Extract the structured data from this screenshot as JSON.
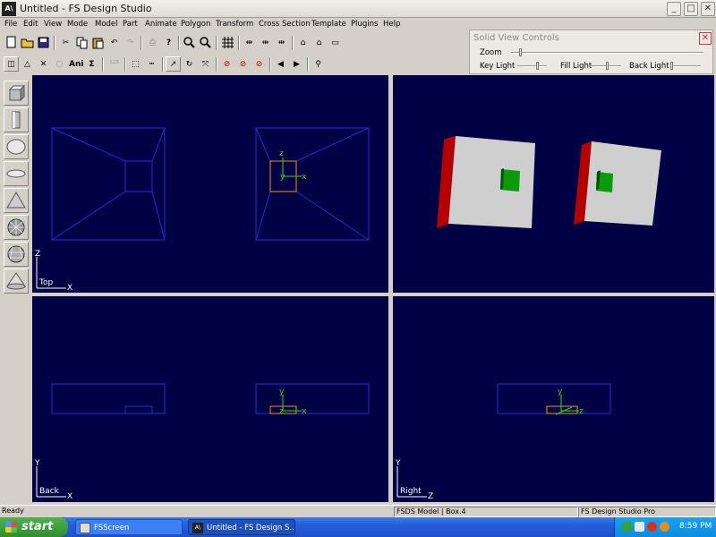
{
  "window": {
    "title": "Untitled - FS Design Studio",
    "app_icon": "fsds-logo-icon",
    "buttons": [
      "minimize-icon",
      "maximize-icon",
      "close-icon"
    ]
  },
  "menu": [
    "File",
    "Edit",
    "View",
    "Mode",
    "Model",
    "Part",
    "Animate",
    "Polygon",
    "Transform",
    "Cross Section",
    "Template",
    "Plugins",
    "Help"
  ],
  "toolbar": {
    "row2_text_buttons": {
      "ani": "Ani",
      "sigma": "Σ"
    }
  },
  "solid_view_controls": {
    "title": "Solid View Controls",
    "zoom": {
      "label": "Zoom",
      "level": 0.05
    },
    "key_light": {
      "label": "Key Light",
      "level": 0.7
    },
    "fill_light": {
      "label": "Fill Light",
      "level": 0.55
    },
    "back_light": {
      "label": "Back Light",
      "level": 0.05
    }
  },
  "viewports": {
    "top": {
      "label": "Top",
      "axis_v": "Z",
      "axis_h": "X"
    },
    "back": {
      "label": "Back",
      "axis_v": "Y",
      "axis_h": "X"
    },
    "right": {
      "label": "Right",
      "axis_v": "Y",
      "axis_h": "Z"
    },
    "gizmo": {
      "x": "x",
      "y": "y",
      "z": "z"
    },
    "colors": {
      "background": "#000044",
      "wire": "#1f2fd0",
      "selection": "#ff8a1a",
      "gizmo": "#22e022",
      "face": "#cfcfcf",
      "edge": "#d01010",
      "hole": "#0a9a0a"
    }
  },
  "status": {
    "left": "Ready",
    "model": "FSDS Model | Box.4",
    "app": "FS Design Studio Pro"
  },
  "taskbar": {
    "start": "start",
    "tasks": [
      {
        "label": "FSScreen"
      },
      {
        "label": "Untitled - FS Design S..."
      }
    ],
    "clock": "8:59 PM"
  }
}
